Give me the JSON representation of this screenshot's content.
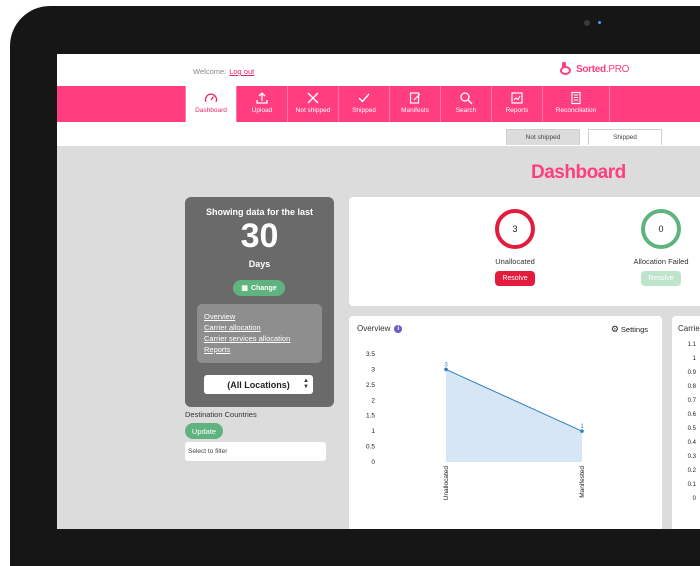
{
  "header": {
    "welcome": "Welcome:",
    "logout": "Log out",
    "logo_main": "Sorted",
    "logo_suffix": ".PRO"
  },
  "nav": {
    "items": [
      {
        "label": "Dashboard",
        "icon": "speedometer-icon",
        "active": true
      },
      {
        "label": "Upload",
        "icon": "upload-icon"
      },
      {
        "label": "Not shipped",
        "icon": "x-icon"
      },
      {
        "label": "Shipped",
        "icon": "check-icon"
      },
      {
        "label": "Manifests",
        "icon": "manifest-icon"
      },
      {
        "label": "Search",
        "icon": "search-icon"
      },
      {
        "label": "Reports",
        "icon": "reports-icon"
      },
      {
        "label": "Reconciliation",
        "icon": "reconciliation-icon"
      }
    ]
  },
  "tabs": {
    "not_shipped": "Not shipped",
    "shipped": "Shipped"
  },
  "page_title": "Dashboard",
  "filter_panel": {
    "heading": "Showing data for the last",
    "number": "30",
    "unit": "Days",
    "change_label": "Change",
    "links": [
      "Overview",
      "Carrier allocation",
      "Carrier services allocation",
      "Reports"
    ],
    "location": "(All Locations)"
  },
  "destination": {
    "label": "Destination Countries",
    "update_label": "Update",
    "filter_placeholder": "Select to filter"
  },
  "stats": {
    "unallocated": {
      "value": "3",
      "label": "Unallocated",
      "action": "Resolve"
    },
    "allocation_failed": {
      "value": "0",
      "label": "Allocation Failed",
      "action": "Resolve"
    }
  },
  "overview": {
    "title": "Overview",
    "info": "i",
    "settings_label": "Settings"
  },
  "chart_data": [
    {
      "type": "area",
      "categories": [
        "Unallocated",
        "Manifested"
      ],
      "values": [
        3,
        1
      ],
      "data_labels": [
        "3",
        "1"
      ],
      "yticks": [
        "0",
        "0.5",
        "1",
        "1.5",
        "2",
        "2.5",
        "3",
        "3.5"
      ],
      "ylim": [
        0,
        3.5
      ],
      "color": "#2f7fc1",
      "fill": "#d6e6f4"
    }
  ],
  "carriers": {
    "title": "Carrie",
    "yticks": [
      "1.1",
      "1",
      "0.9",
      "0.8",
      "0.7",
      "0.6",
      "0.5",
      "0.4",
      "0.3",
      "0.2",
      "0.1",
      "0"
    ]
  },
  "colors": {
    "brand": "#ff3d7f",
    "danger": "#e31b3c",
    "success": "#5fb37f"
  }
}
